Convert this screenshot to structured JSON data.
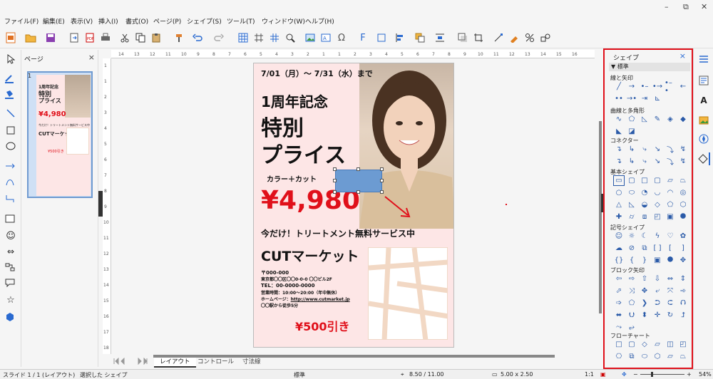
{
  "window": {
    "minimize": "–",
    "restore": "⧉",
    "close": "✕"
  },
  "menu": [
    "ファイル(F)",
    "編集(E)",
    "表示(V)",
    "挿入(I)",
    "書式(O)",
    "ページ(P)",
    "シェイプ(S)",
    "ツール(T)",
    "ウィンドウ(W)",
    "ヘルプ(H)"
  ],
  "pages_panel": {
    "title": "ページ",
    "close": "×",
    "thumb_number": "1"
  },
  "slide": {
    "date": "7/01（月）～ 7/31（水）まで",
    "headline1": "1周年記念",
    "headline2": "特別",
    "headline3": "プライス",
    "service": "カラー＋カット",
    "price": "¥4,980",
    "promo": "今だけ！トリートメント無料サービス中",
    "shop": "CUTマーケット",
    "postal": "〒000-000",
    "address": "東京都〇〇区〇〇0-0-0 〇〇ビル2F",
    "tel": "TEL：00-0000-0000",
    "hours": "営業時間：10:00～20:00（年中無休）",
    "homepage_label": "ホームページ：",
    "homepage_url": "http://www.cutmarket.jp",
    "access": "〇〇駅から徒歩5分",
    "coupon": "¥500引き",
    "brand_red": "#e0101a",
    "bg_pink": "#fde6e6"
  },
  "tabs": [
    "レイアウト",
    "コントロール",
    "寸法線"
  ],
  "shapes_panel": {
    "title": "シェイプ",
    "close": "×",
    "group": "標準",
    "sections": [
      "線と矢印",
      "曲線と多角形",
      "コネクター",
      "基本シェイプ",
      "記号シェイプ",
      "ブロック矢印",
      "フローチャート"
    ]
  },
  "status": {
    "slide": "スライド 1 / 1 (レイアウト)",
    "selection": "選択した シェイプ",
    "layout": "標準",
    "position": "8.50 / 11.00",
    "size": "5.00 x 2.50",
    "ratio": "1:1",
    "zoom": "54%"
  }
}
